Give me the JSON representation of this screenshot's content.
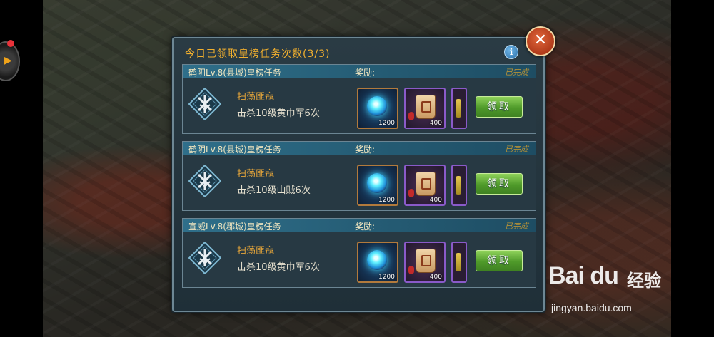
{
  "dialog": {
    "title": "今日已领取皇榜任务次数(3/3)",
    "info_icon": "info-icon",
    "close_icon": "close-icon"
  },
  "tasks": [
    {
      "name": "鹤阴Lv.8(县城)皇榜任务",
      "reward_label": "奖励:",
      "status": "已完成",
      "title": "扫荡匪寇",
      "desc": "击杀10级黄巾军6次",
      "rewards": [
        {
          "icon": "spirit-orb-icon",
          "count": "1200"
        },
        {
          "icon": "command-token-icon",
          "count": "400"
        },
        {
          "icon": "key-icon",
          "count": ""
        }
      ],
      "claim_label": "领取"
    },
    {
      "name": "鹤阴Lv.8(县城)皇榜任务",
      "reward_label": "奖励:",
      "status": "已完成",
      "title": "扫荡匪寇",
      "desc": "击杀10级山贼6次",
      "rewards": [
        {
          "icon": "spirit-orb-icon",
          "count": "1200"
        },
        {
          "icon": "command-token-icon",
          "count": "400"
        },
        {
          "icon": "key-icon",
          "count": ""
        }
      ],
      "claim_label": "领取"
    },
    {
      "name": "宣威Lv.8(郡城)皇榜任务",
      "reward_label": "奖励:",
      "status": "已完成",
      "title": "扫荡匪寇",
      "desc": "击杀10级黄巾军6次",
      "rewards": [
        {
          "icon": "spirit-orb-icon",
          "count": "1200"
        },
        {
          "icon": "command-token-icon",
          "count": "400"
        },
        {
          "icon": "key-icon",
          "count": ""
        }
      ],
      "claim_label": "领取"
    }
  ],
  "watermark": {
    "logo": "Bai du",
    "cn": "经验",
    "url": "jingyan.baidu.com"
  },
  "colors": {
    "title": "#f2b02e",
    "claim": "#4f9a2a",
    "close": "#b03a1a"
  }
}
